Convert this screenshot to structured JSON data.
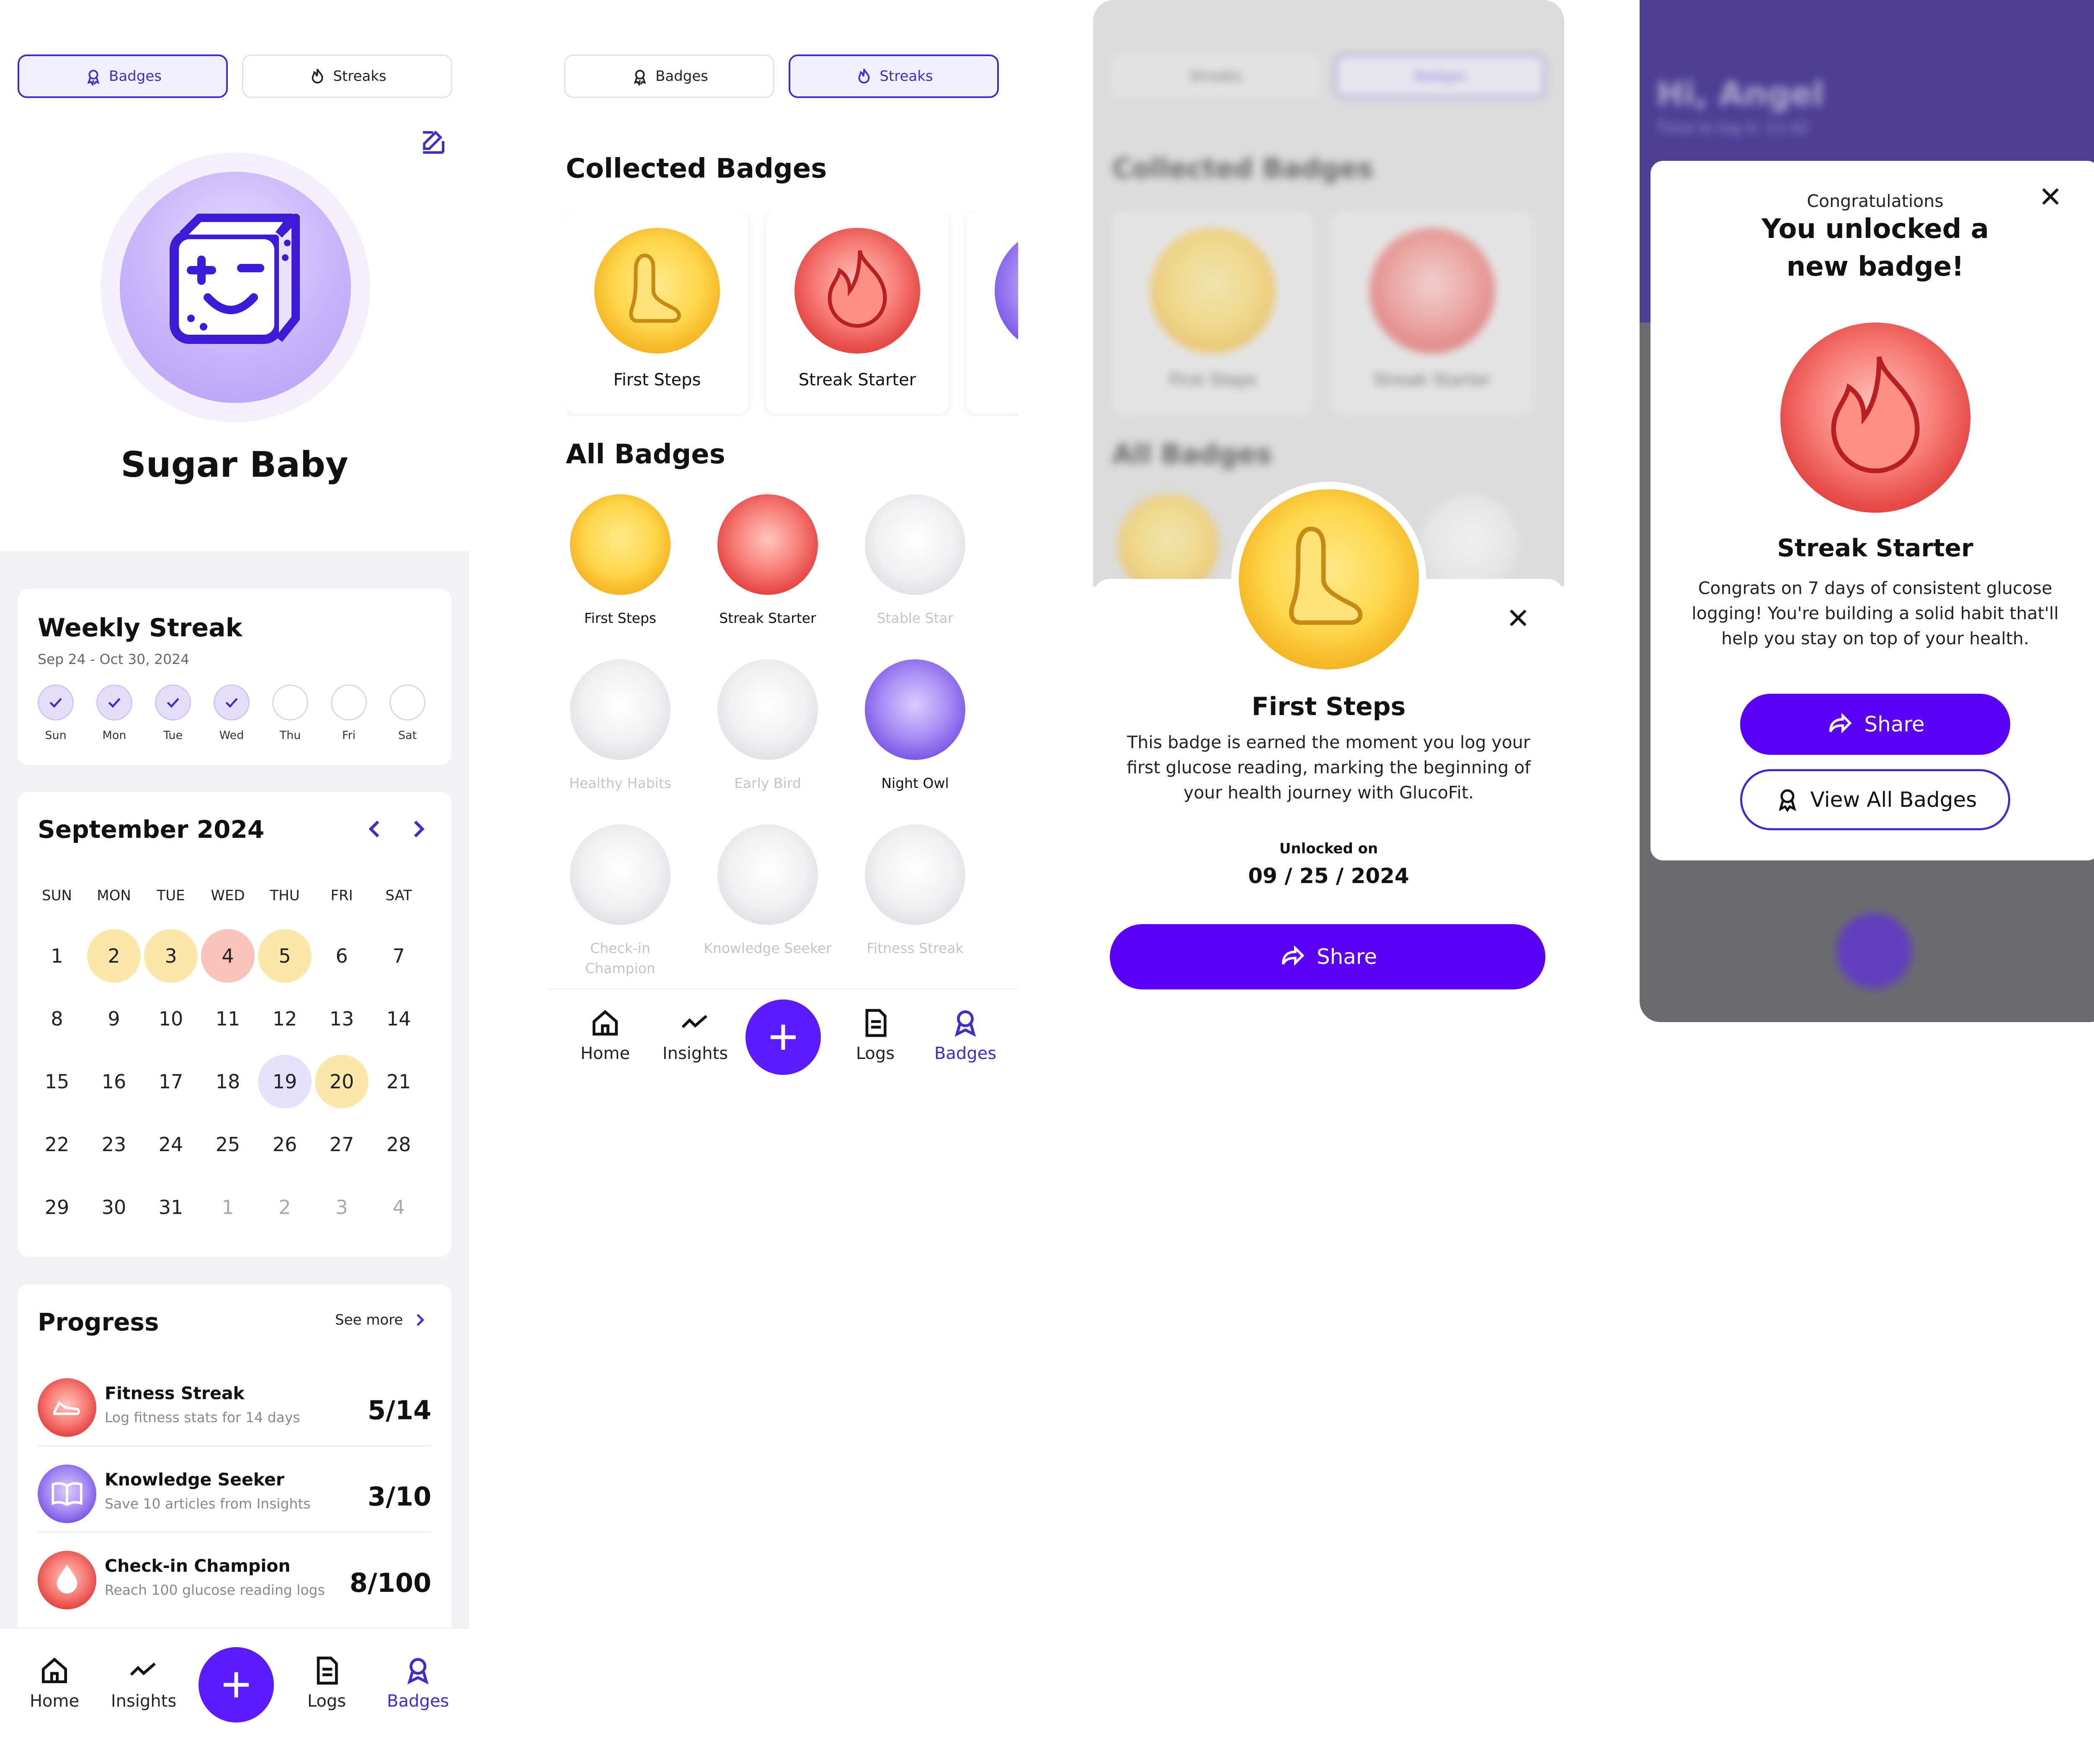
{
  "screen1": {
    "tabs": {
      "badges": "Badges",
      "streaks": "Streaks"
    },
    "profile_name": "Sugar Baby",
    "weekly": {
      "title": "Weekly Streak",
      "range": "Sep 24 - Oct 30, 2024",
      "days": [
        {
          "label": "Sun",
          "done": true
        },
        {
          "label": "Mon",
          "done": true
        },
        {
          "label": "Tue",
          "done": true
        },
        {
          "label": "Wed",
          "done": true
        },
        {
          "label": "Thu",
          "done": false
        },
        {
          "label": "Fri",
          "done": false
        },
        {
          "label": "Sat",
          "done": false
        }
      ]
    },
    "calendar": {
      "month": "September 2024",
      "headers": [
        "SUN",
        "MON",
        "TUE",
        "WED",
        "THU",
        "FRI",
        "SAT"
      ],
      "rows": [
        [
          "1",
          "2",
          "3",
          "4",
          "5",
          "6",
          "7"
        ],
        [
          "8",
          "9",
          "10",
          "11",
          "12",
          "13",
          "14"
        ],
        [
          "15",
          "16",
          "17",
          "18",
          "19",
          "20",
          "21"
        ],
        [
          "22",
          "23",
          "24",
          "25",
          "26",
          "27",
          "28"
        ],
        [
          "29",
          "30",
          "31",
          "1",
          "2",
          "3",
          "4"
        ]
      ]
    },
    "progress": {
      "title": "Progress",
      "see_more": "See more",
      "items": [
        {
          "name": "Fitness Streak",
          "desc": "Log fitness stats for 14 days",
          "value": "5/14"
        },
        {
          "name": "Knowledge Seeker",
          "desc": "Save 10 articles from Insights",
          "value": "3/10"
        },
        {
          "name": "Check-in Champion",
          "desc": "Reach 100 glucose reading logs",
          "value": "8/100"
        }
      ]
    }
  },
  "nav": {
    "home": "Home",
    "insights": "Insights",
    "logs": "Logs",
    "badges": "Badges"
  },
  "screen2": {
    "tabs": {
      "badges": "Badges",
      "streaks": "Streaks"
    },
    "collected_title": "Collected Badges",
    "collected": [
      "First Steps",
      "Streak Starter"
    ],
    "all_title": "All Badges",
    "all": [
      "First Steps",
      "Streak Starter",
      "Stable Star",
      "Healthy Habits",
      "Early Bird",
      "Night Owl",
      "Check-in Champion",
      "Knowledge Seeker",
      "Fitness Streak"
    ]
  },
  "screen3": {
    "background": {
      "tabs": {
        "streaks": "Streaks",
        "badges": "Badges"
      },
      "collected_title": "Collected Badges",
      "collected": [
        "First Steps",
        "Streak Starter"
      ],
      "all_title": "All Badges"
    },
    "title": "First Steps",
    "desc": "This badge is earned the moment you log your first glucose reading, marking the beginning of your health journey with GlucoFit.",
    "unlocked_label": "Unlocked on",
    "unlocked_date": "09 / 25 / 2024",
    "share": "Share"
  },
  "screen4": {
    "background": {
      "greeting": "Hi, Angel",
      "subtitle": "Time to log it: 11:42"
    },
    "congrats": "Congratulations",
    "headline_1": "You unlocked a",
    "headline_2": "new badge!",
    "badge_name": "Streak Starter",
    "desc": "Congrats on 7 days of consistent glucose logging! You're building a solid habit that'll help you stay on top of your health.",
    "share": "Share",
    "view_all": "View All Badges"
  },
  "colors": {
    "accent": "#5a00f5",
    "accent_dark": "#3b2ecb",
    "gold": "#ffd84e",
    "red": "#e54a47",
    "purple": "#7b55e6"
  }
}
